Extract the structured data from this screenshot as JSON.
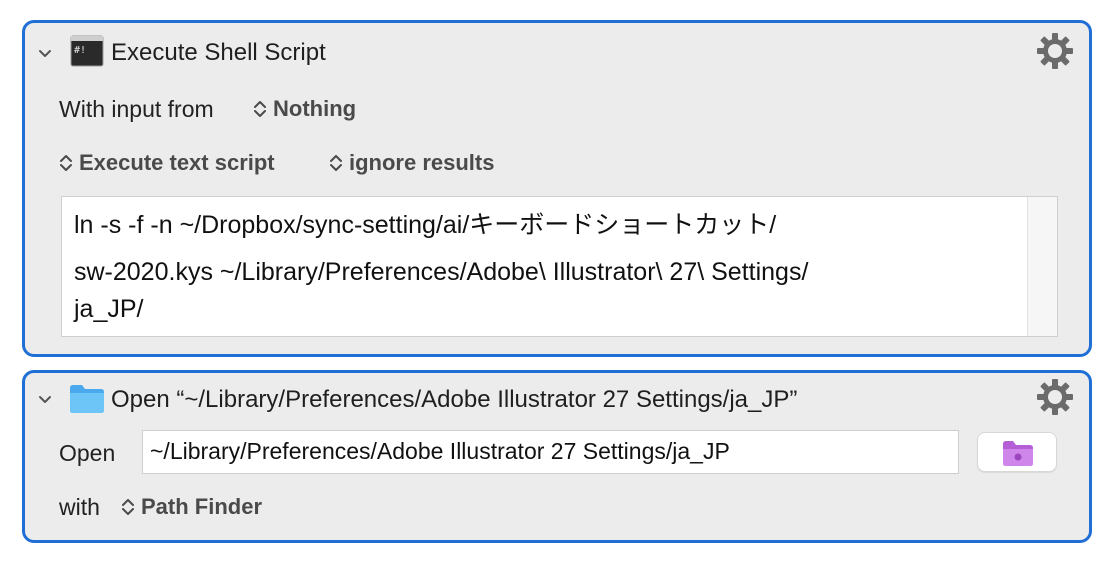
{
  "action1": {
    "title": "Execute Shell Script",
    "input_label": "With input from",
    "input_value": "Nothing",
    "execute_mode": "Execute text script",
    "results_mode": "ignore results",
    "script_lines": [
      "ln -s -f -n ~/Dropbox/sync-setting/ai/キーボードショートカット/",
      "sw-2020.kys ~/Library/Preferences/Adobe\\ Illustrator\\ 27\\ Settings/",
      "ja_JP/"
    ]
  },
  "action2": {
    "title": "Open “~/Library/Preferences/Adobe Illustrator 27 Settings/ja_JP”",
    "open_label": "Open",
    "path_value": "~/Library/Preferences/Adobe Illustrator 27 Settings/ja_JP",
    "with_label": "with",
    "app_value": "Path Finder"
  },
  "colors": {
    "selection_border": "#1f6fd6",
    "panel_bg": "#ececec",
    "folder_blue": "#5eb8f2",
    "folder_purple": "#c77ae0"
  },
  "icons": [
    "chevron-down-icon",
    "terminal-icon",
    "gear-icon",
    "folder-icon",
    "updown-icon"
  ]
}
